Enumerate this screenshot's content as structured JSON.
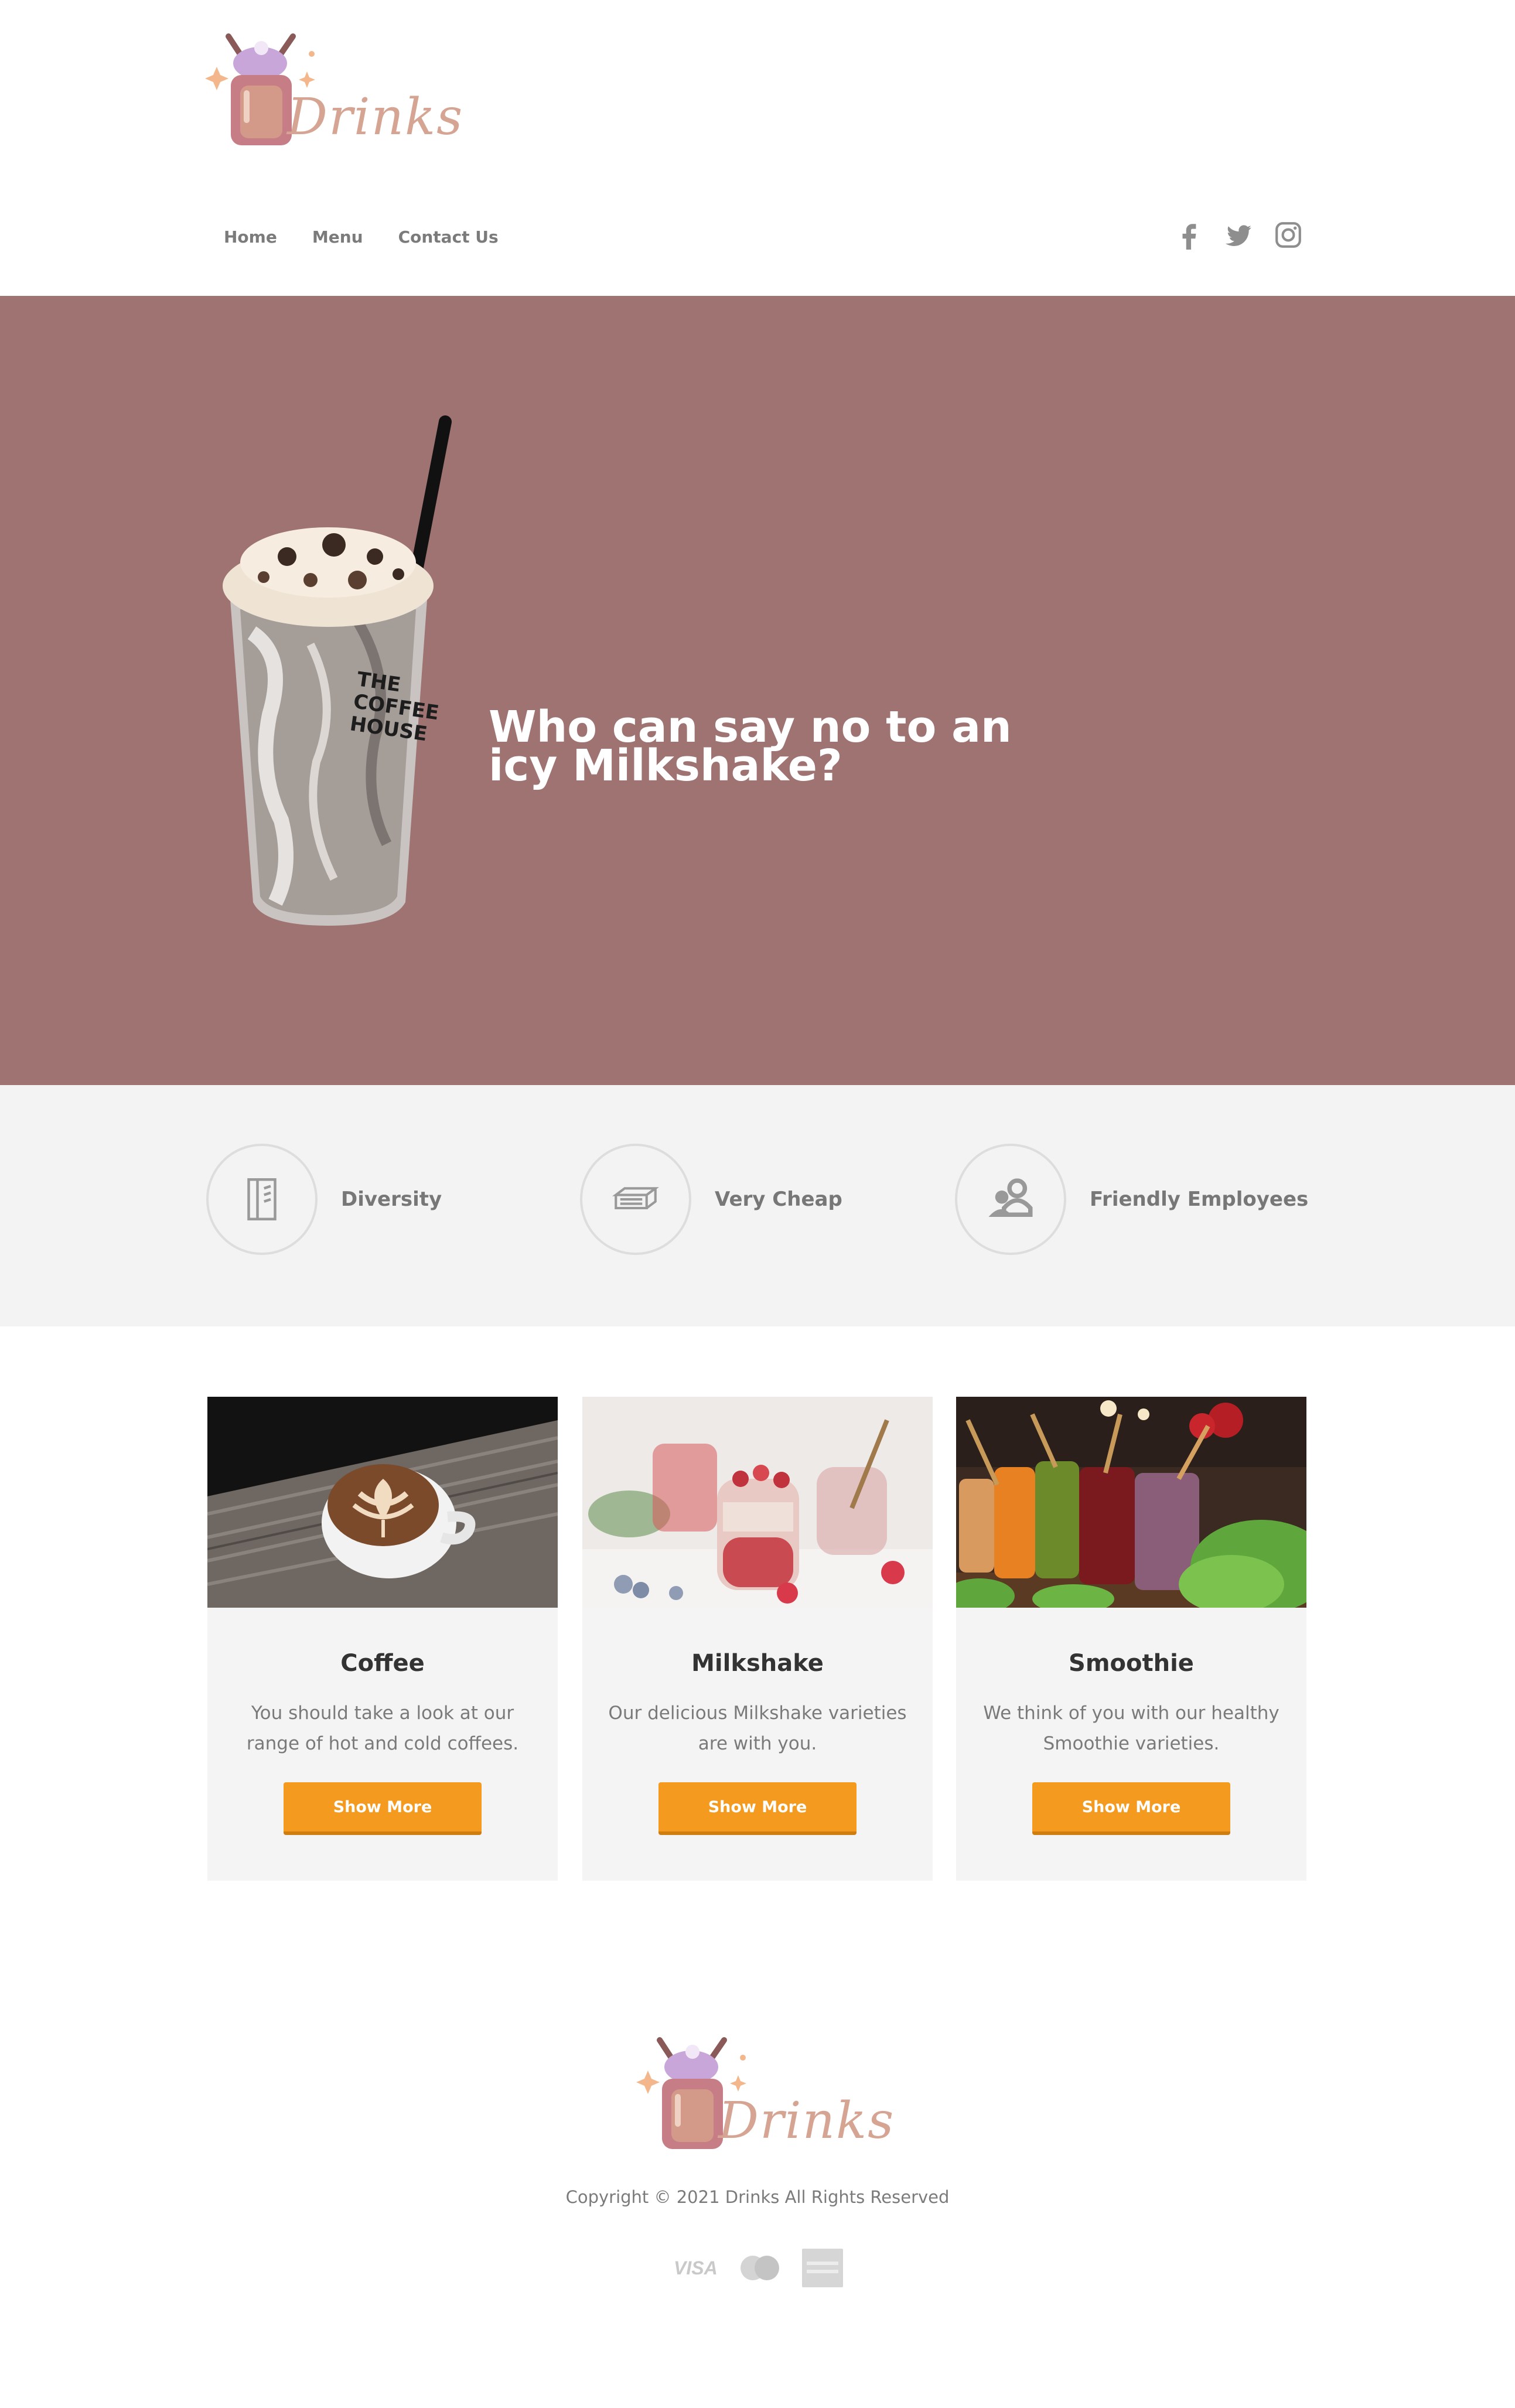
{
  "brand": {
    "name": "Drinks"
  },
  "nav": {
    "items": [
      "Home",
      "Menu",
      "Contact Us"
    ]
  },
  "social": [
    "facebook-icon",
    "twitter-icon",
    "instagram-icon"
  ],
  "hero": {
    "title": "Who can say no to an icy Milkshake?",
    "cup_text": "THE COFFEE HOUSE",
    "background": "#9e7372"
  },
  "features": [
    {
      "label": "Diversity",
      "icon": "menu-book-icon"
    },
    {
      "label": "Very Cheap",
      "icon": "money-stack-icon"
    },
    {
      "label": "Friendly Employees",
      "icon": "users-icon"
    }
  ],
  "cards": [
    {
      "title": "Coffee",
      "text": "You should take a look at our range of hot and cold coffees.",
      "button": "Show More"
    },
    {
      "title": "Milkshake",
      "text": "Our delicious Milkshake varieties are with you.",
      "button": "Show More"
    },
    {
      "title": "Smoothie",
      "text": "We think of you with our healthy Smoothie varieties.",
      "button": "Show More"
    }
  ],
  "footer": {
    "copyright": "Copyright © 2021 Drinks All Rights Reserved",
    "payments": [
      "VISA",
      "mastercard-icon",
      "amex-icon"
    ]
  },
  "colors": {
    "accent": "#f39a1f",
    "hero": "#9e7372",
    "logo_text": "#d6a493"
  }
}
